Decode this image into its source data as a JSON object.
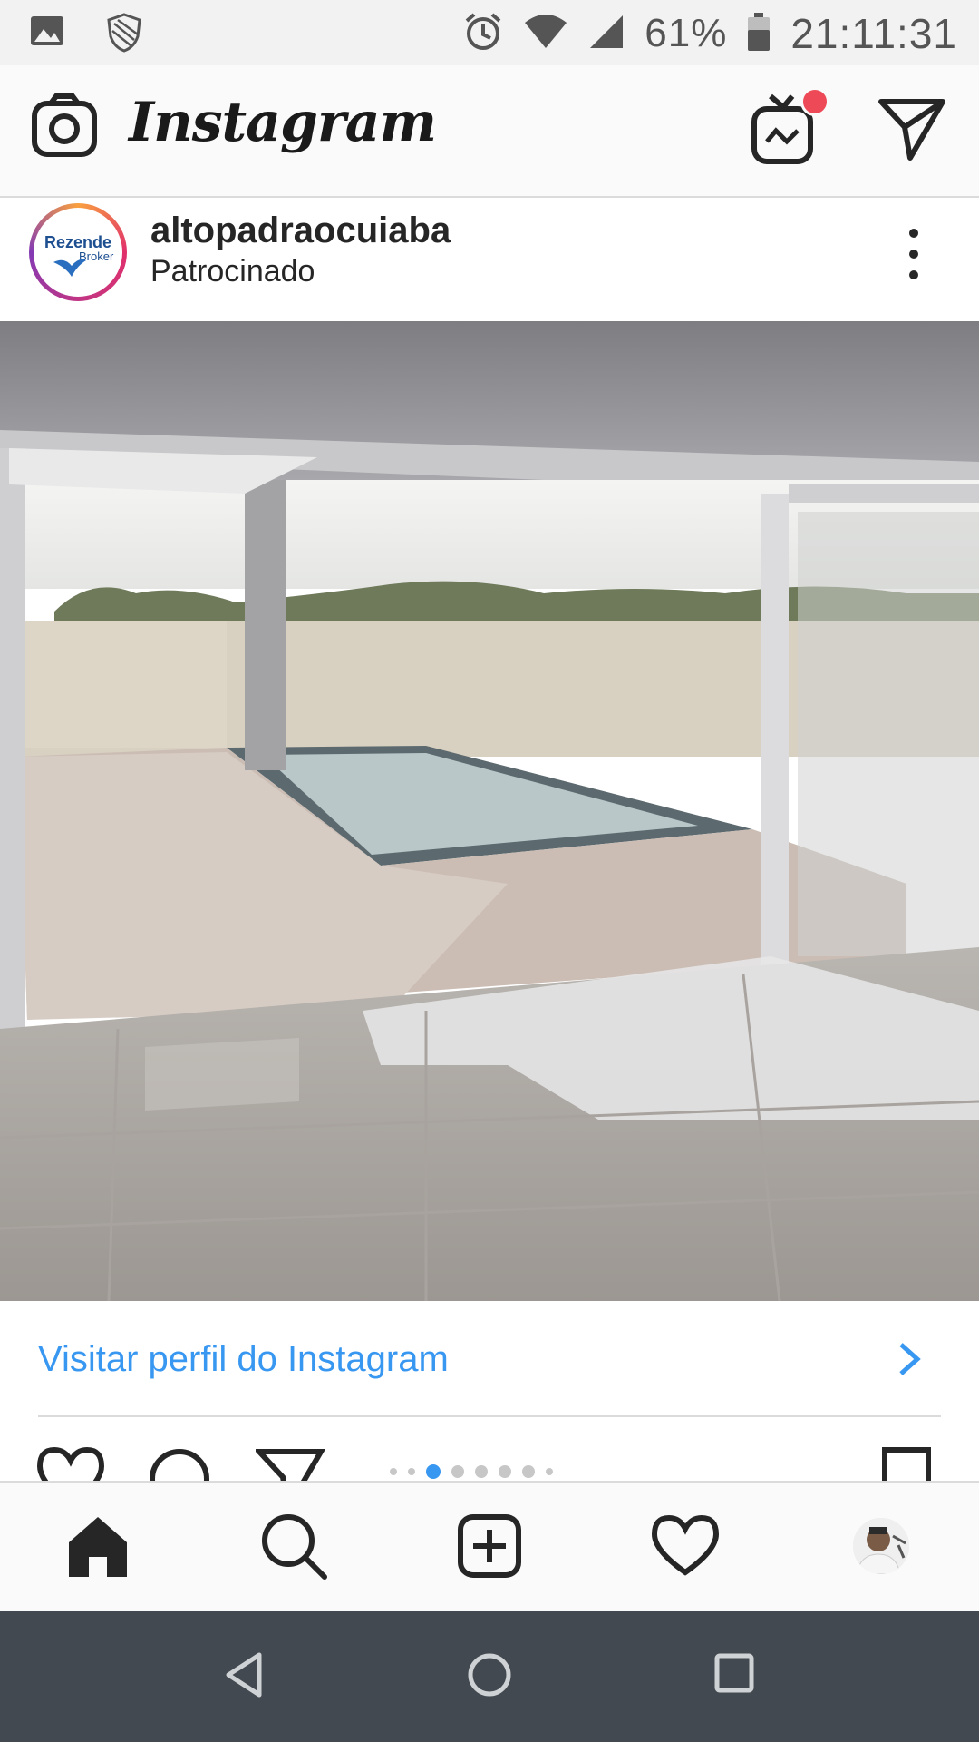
{
  "status_bar": {
    "battery_text": "61%",
    "time": "21:11:31",
    "icons": [
      "gallery-icon",
      "shield-icon",
      "alarm-icon",
      "wifi-icon",
      "signal-icon",
      "battery-icon"
    ]
  },
  "header": {
    "app_name": "Instagram",
    "icons": [
      "camera-icon",
      "igtv-icon",
      "direct-message-icon"
    ],
    "igtv_has_notification": true
  },
  "post": {
    "username": "altopadraocuiaba",
    "subtitle": "Patrocinado",
    "avatar_text_primary": "Rezende",
    "avatar_text_secondary": "Broker",
    "image_description_icon": "photo",
    "carousel": {
      "count": 7,
      "active_index": 1
    },
    "cta_label": "Visitar perfil do Instagram"
  },
  "tab_bar": {
    "items": [
      "home",
      "search",
      "new-post",
      "activity",
      "profile"
    ],
    "active": "home"
  },
  "nav_bar": {
    "items": [
      "back",
      "home",
      "recents"
    ]
  },
  "colors": {
    "accent_blue": "#3897f0",
    "notification_red": "#ed4956",
    "nav_bar": "#424950"
  }
}
